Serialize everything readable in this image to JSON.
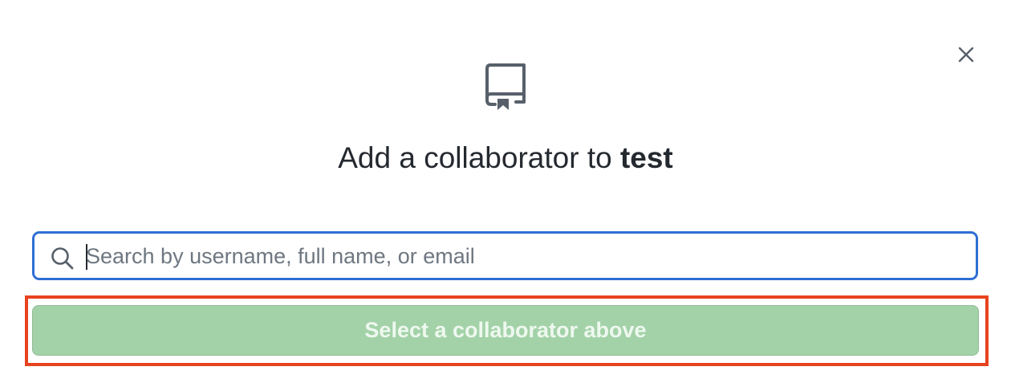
{
  "dialog": {
    "title_prefix": "Add a collaborator to",
    "repo_name": "test",
    "icons": {
      "close": "close-icon",
      "repo": "repo-icon",
      "search": "search-icon"
    }
  },
  "search": {
    "placeholder": "Search by username, full name, or email",
    "value": ""
  },
  "confirm_button": {
    "label": "Select a collaborator above",
    "disabled": true,
    "color": "#a3d2a8"
  },
  "colors": {
    "focus_border": "#2f6fd5",
    "highlight_border": "#e8431f",
    "text": "#24292f",
    "icon": "#57606a"
  }
}
